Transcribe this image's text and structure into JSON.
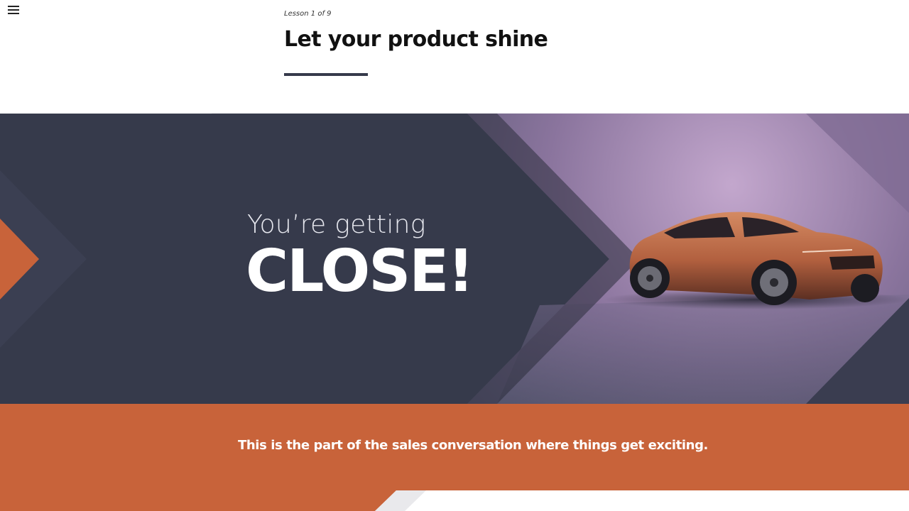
{
  "header": {
    "menu_icon": "hamburger-menu-icon",
    "lesson_label": "Lesson 1 of 9",
    "title": "Let your product shine"
  },
  "hero": {
    "intro": "You’re getting",
    "headline": "CLOSE!",
    "image_subject": "car",
    "colors": {
      "dark": "#363a4b",
      "accent": "#c8633a",
      "purple": "#8c769e"
    }
  },
  "banner": {
    "text": "This is the part of the sales conversation where things get exciting.",
    "background": "#c8633a"
  }
}
